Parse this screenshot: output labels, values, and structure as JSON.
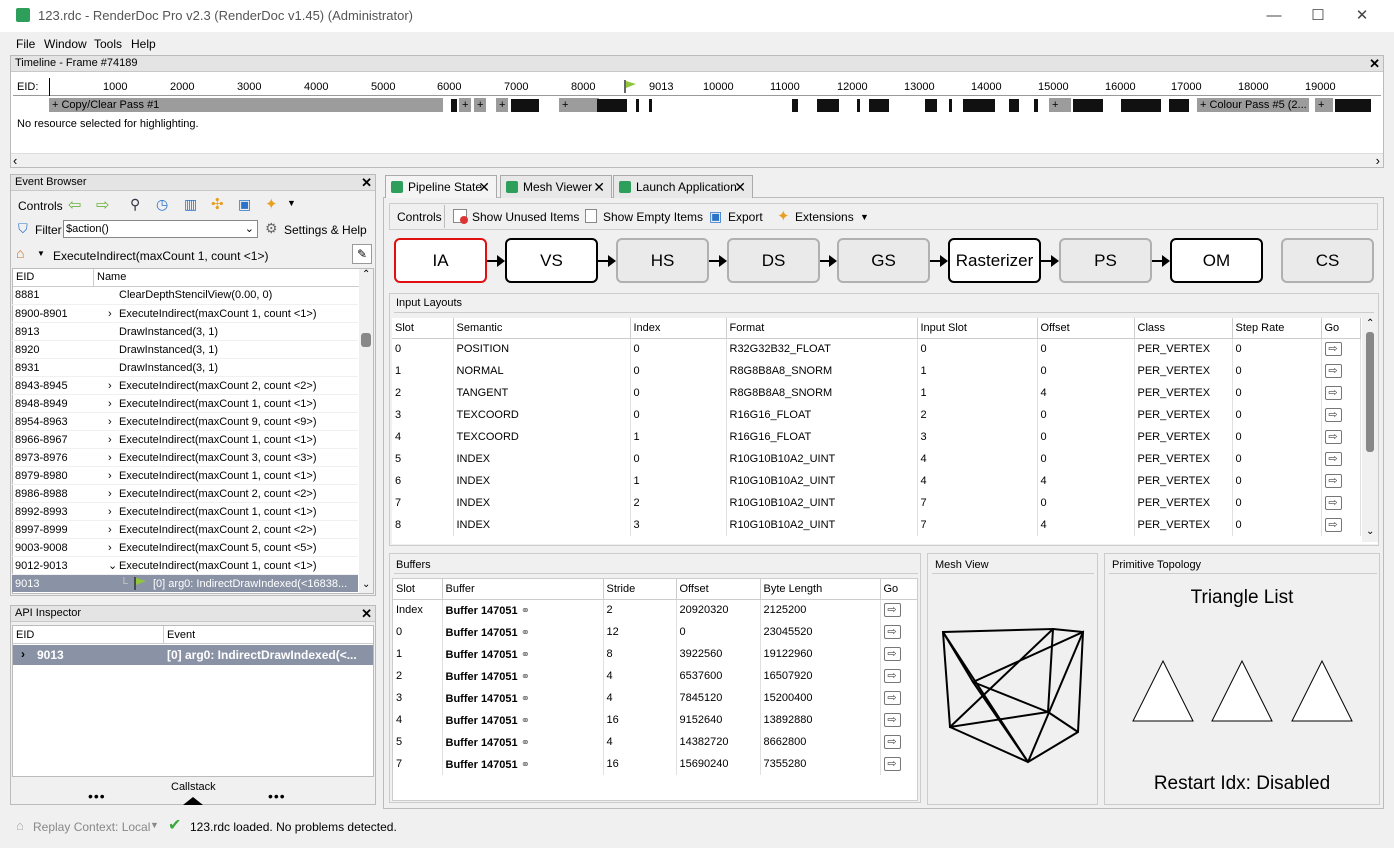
{
  "window": {
    "title": "123.rdc - RenderDoc Pro v2.3 (RenderDoc v1.45) (Administrator)",
    "min": "—",
    "max": "☐",
    "close": "✕"
  },
  "menu": {
    "file": "File",
    "window": "Window",
    "tools": "Tools",
    "help": "Help"
  },
  "timeline": {
    "title": "Timeline - Frame #74189",
    "eid_label": "EID:",
    "ticks": [
      "1000",
      "2000",
      "3000",
      "4000",
      "5000",
      "6000",
      "7000",
      "8000",
      "9013",
      "10000",
      "11000",
      "12000",
      "13000",
      "14000",
      "15000",
      "16000",
      "17000",
      "18000",
      "19000"
    ],
    "pass1": "+ Copy/Clear Pass #1",
    "pass5": "+ Colour Pass #5 (2...",
    "plus": "+",
    "status": "No resource selected for highlighting."
  },
  "event_browser": {
    "title": "Event Browser",
    "controls": "Controls",
    "filter_label": "Filter",
    "filter_value": "$action()",
    "settings": "Settings & Help",
    "breadcrumb": "ExecuteIndirect(maxCount 1, count <1>)",
    "col_eid": "EID",
    "col_name": "Name",
    "rows": [
      {
        "eid": "8881",
        "name": "ClearDepthStencilView(0.00, 0)",
        "chev": ""
      },
      {
        "eid": "8900-8901",
        "name": "ExecuteIndirect(maxCount 1, count <1>)",
        "chev": "›"
      },
      {
        "eid": "8913",
        "name": "DrawInstanced(3, 1)",
        "chev": ""
      },
      {
        "eid": "8920",
        "name": "DrawInstanced(3, 1)",
        "chev": ""
      },
      {
        "eid": "8931",
        "name": "DrawInstanced(3, 1)",
        "chev": ""
      },
      {
        "eid": "8943-8945",
        "name": "ExecuteIndirect(maxCount 2, count <2>)",
        "chev": "›"
      },
      {
        "eid": "8948-8949",
        "name": "ExecuteIndirect(maxCount 1, count <1>)",
        "chev": "›"
      },
      {
        "eid": "8954-8963",
        "name": "ExecuteIndirect(maxCount 9, count <9>)",
        "chev": "›"
      },
      {
        "eid": "8966-8967",
        "name": "ExecuteIndirect(maxCount 1, count <1>)",
        "chev": "›"
      },
      {
        "eid": "8973-8976",
        "name": "ExecuteIndirect(maxCount 3, count <3>)",
        "chev": "›"
      },
      {
        "eid": "8979-8980",
        "name": "ExecuteIndirect(maxCount 1, count <1>)",
        "chev": "›"
      },
      {
        "eid": "8986-8988",
        "name": "ExecuteIndirect(maxCount 2, count <2>)",
        "chev": "›"
      },
      {
        "eid": "8992-8993",
        "name": "ExecuteIndirect(maxCount 1, count <1>)",
        "chev": "›"
      },
      {
        "eid": "8997-8999",
        "name": "ExecuteIndirect(maxCount 2, count <2>)",
        "chev": "›"
      },
      {
        "eid": "9003-9008",
        "name": "ExecuteIndirect(maxCount 5, count <5>)",
        "chev": "›"
      },
      {
        "eid": "9012-9013",
        "name": "ExecuteIndirect(maxCount 1, count <1>)",
        "chev": "⌄"
      },
      {
        "eid": "9013",
        "name": "[0] arg0: IndirectDrawIndexed(<16838...",
        "chev": ""
      }
    ]
  },
  "api_inspector": {
    "title": "API Inspector",
    "col_eid": "EID",
    "col_event": "Event",
    "row_eid": "9013",
    "row_event": "[0] arg0: IndirectDrawIndexed(<...",
    "callstack": "Callstack",
    "dots": "•••"
  },
  "tabs": {
    "pipeline": "Pipeline State",
    "mesh": "Mesh Viewer",
    "launch": "Launch Application",
    "close": "✕"
  },
  "pipeline_toolbar": {
    "controls": "Controls",
    "unused": "Show Unused Items",
    "empty": "Show Empty Items",
    "export": "Export",
    "extensions": "Extensions"
  },
  "stages": [
    "IA",
    "VS",
    "HS",
    "DS",
    "GS",
    "Rasterizer",
    "PS",
    "OM",
    "CS"
  ],
  "input_layouts": {
    "title": "Input Layouts",
    "headers": [
      "Slot",
      "Semantic",
      "Index",
      "Format",
      "Input Slot",
      "Offset",
      "Class",
      "Step Rate",
      "Go"
    ],
    "rows": [
      [
        "0",
        "POSITION",
        "0",
        "R32G32B32_FLOAT",
        "0",
        "0",
        "PER_VERTEX",
        "0"
      ],
      [
        "1",
        "NORMAL",
        "0",
        "R8G8B8A8_SNORM",
        "1",
        "0",
        "PER_VERTEX",
        "0"
      ],
      [
        "2",
        "TANGENT",
        "0",
        "R8G8B8A8_SNORM",
        "1",
        "4",
        "PER_VERTEX",
        "0"
      ],
      [
        "3",
        "TEXCOORD",
        "0",
        "R16G16_FLOAT",
        "2",
        "0",
        "PER_VERTEX",
        "0"
      ],
      [
        "4",
        "TEXCOORD",
        "1",
        "R16G16_FLOAT",
        "3",
        "0",
        "PER_VERTEX",
        "0"
      ],
      [
        "5",
        "INDEX",
        "0",
        "R10G10B10A2_UINT",
        "4",
        "0",
        "PER_VERTEX",
        "0"
      ],
      [
        "6",
        "INDEX",
        "1",
        "R10G10B10A2_UINT",
        "4",
        "4",
        "PER_VERTEX",
        "0"
      ],
      [
        "7",
        "INDEX",
        "2",
        "R10G10B10A2_UINT",
        "7",
        "0",
        "PER_VERTEX",
        "0"
      ],
      [
        "8",
        "INDEX",
        "3",
        "R10G10B10A2_UINT",
        "7",
        "4",
        "PER_VERTEX",
        "0"
      ]
    ]
  },
  "buffers": {
    "title": "Buffers",
    "headers": [
      "Slot",
      "Buffer",
      "Stride",
      "Offset",
      "Byte Length",
      "Go"
    ],
    "rows": [
      [
        "Index",
        "Buffer 147051",
        "2",
        "20920320",
        "2125200"
      ],
      [
        "0",
        "Buffer 147051",
        "12",
        "0",
        "23045520"
      ],
      [
        "1",
        "Buffer 147051",
        "8",
        "3922560",
        "19122960"
      ],
      [
        "2",
        "Buffer 147051",
        "4",
        "6537600",
        "16507920"
      ],
      [
        "3",
        "Buffer 147051",
        "4",
        "7845120",
        "15200400"
      ],
      [
        "4",
        "Buffer 147051",
        "16",
        "9152640",
        "13892880"
      ],
      [
        "5",
        "Buffer 147051",
        "4",
        "14382720",
        "8662800"
      ],
      [
        "7",
        "Buffer 147051",
        "16",
        "15690240",
        "7355280"
      ]
    ]
  },
  "mesh_view": {
    "title": "Mesh View"
  },
  "topology": {
    "title": "Primitive Topology",
    "type": "Triangle List",
    "restart": "Restart Idx: Disabled"
  },
  "statusbar": {
    "replay": "Replay Context: Local",
    "loaded": "123.rdc loaded. No problems detected."
  },
  "colors": {
    "selected_stage": "#e01010",
    "selection": "#8a93a6",
    "app_icon": "#2e9e5b"
  }
}
